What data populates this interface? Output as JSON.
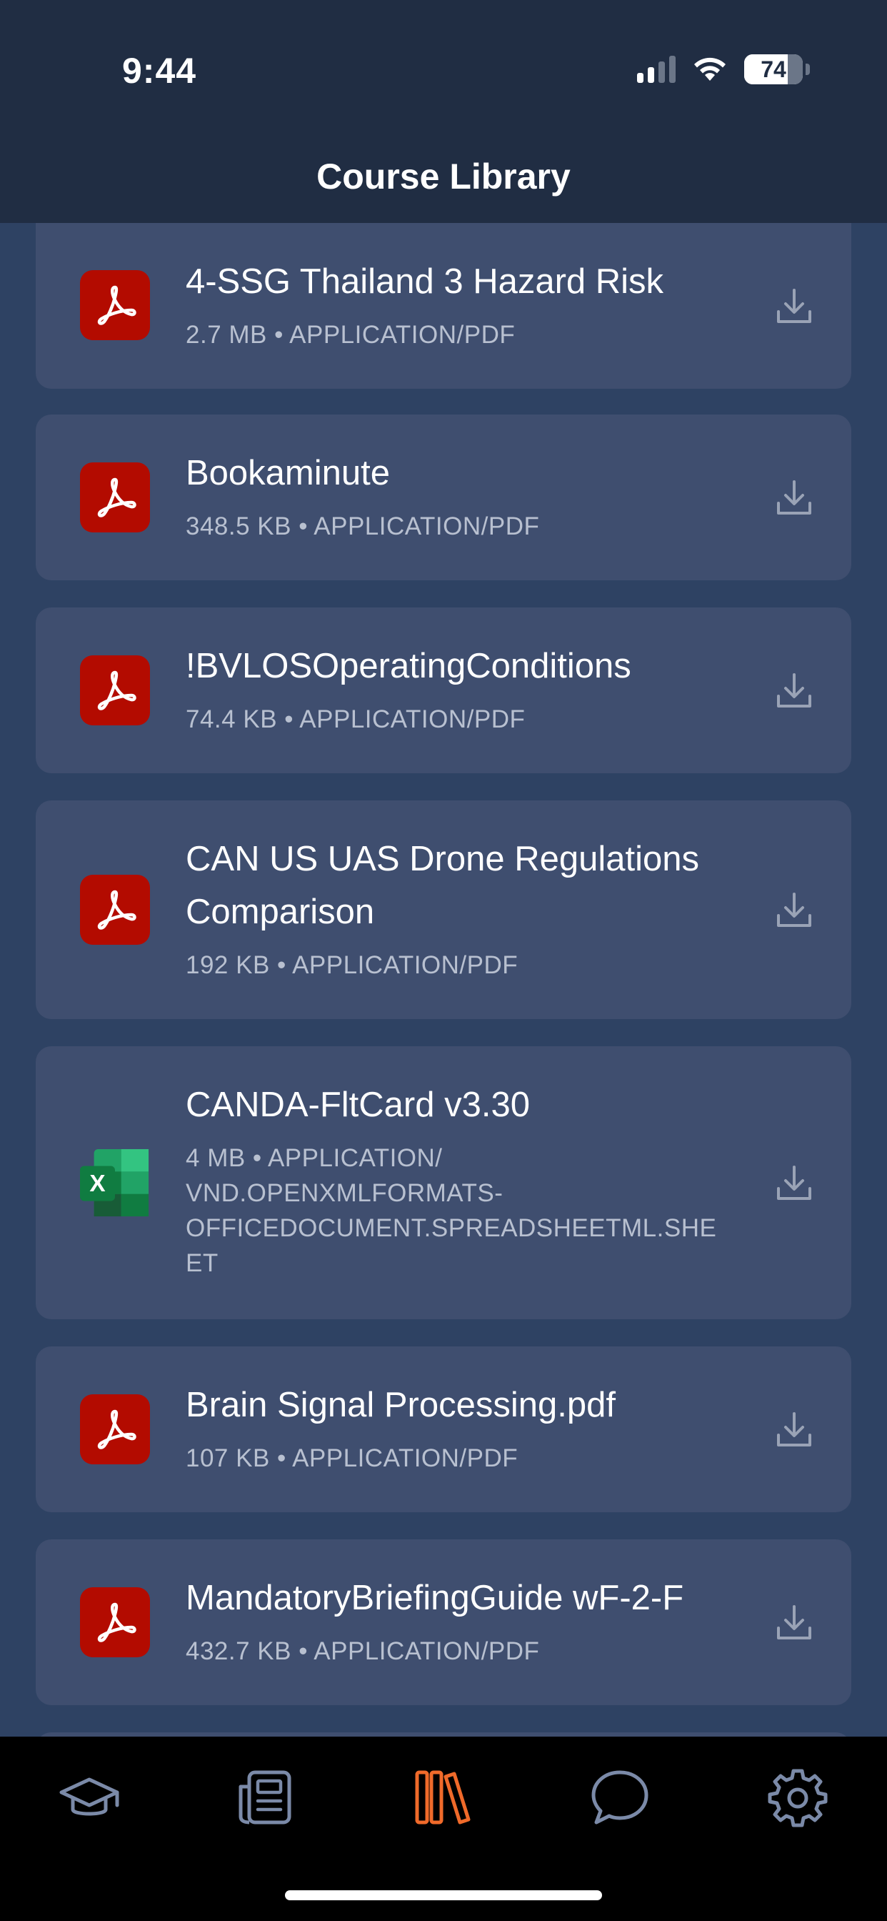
{
  "status_bar": {
    "time": "9:44",
    "battery": "74",
    "battery_level": 0.74
  },
  "header": {
    "title": "Course Library"
  },
  "files": [
    {
      "name": "4-SSG Thailand 3 Hazard Risk",
      "meta": "2.7 MB • APPLICATION/PDF",
      "type": "pdf"
    },
    {
      "name": "Bookaminute",
      "meta": "348.5 KB • APPLICATION/PDF",
      "type": "pdf"
    },
    {
      "name": "!BVLOSOperatingConditions",
      "meta": "74.4 KB • APPLICATION/PDF",
      "type": "pdf"
    },
    {
      "name_line1": "CAN US UAS Drone Regulations",
      "name_line2": "Comparison",
      "meta": "192 KB • APPLICATION/PDF",
      "type": "pdf"
    },
    {
      "name": "CANDA-FltCard v3.30",
      "meta_line1": "4 MB • APPLICATION/",
      "meta_line2": "VND.OPENXMLFORMATS-",
      "meta_line3": "OFFICEDOCUMENT.SPREADSHEETML.SHE",
      "meta_line4": "ET",
      "type": "excel"
    },
    {
      "name": "Brain Signal Processing.pdf",
      "meta": "107 KB • APPLICATION/PDF",
      "type": "pdf"
    },
    {
      "name": "MandatoryBriefingGuide wF-2-F",
      "meta": "432.7 KB • APPLICATION/PDF",
      "type": "pdf"
    }
  ],
  "excel_letter": "X",
  "tabs": [
    {
      "icon": "graduation-cap-icon",
      "active": false
    },
    {
      "icon": "newspaper-icon",
      "active": false
    },
    {
      "icon": "library-icon",
      "active": true
    },
    {
      "icon": "chat-bubble-icon",
      "active": false
    },
    {
      "icon": "gear-icon",
      "active": false
    }
  ],
  "colors": {
    "header_bg": "#202d43",
    "page_bg": "#2e4263",
    "card_bg": "#3f4e6f",
    "pdf_red": "#b30b00",
    "excel_green": "#1e7a45",
    "tab_active": "#f06a2a",
    "tab_inactive": "#7b8aa8"
  }
}
